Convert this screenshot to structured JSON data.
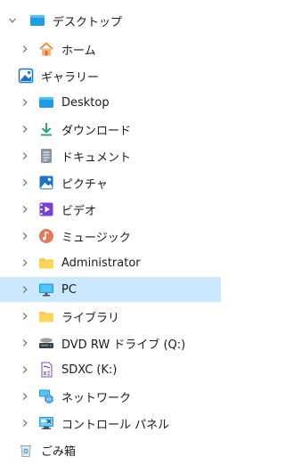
{
  "tree": {
    "root": {
      "label": "デスクトップ",
      "icon": "desktop-folder-icon",
      "expanded": true
    },
    "items": [
      {
        "label": "ホーム",
        "icon": "home-icon",
        "expandable": true
      },
      {
        "label": "ギャラリー",
        "icon": "gallery-icon",
        "expandable": false
      },
      {
        "label": "Desktop",
        "icon": "desktop-folder-icon",
        "expandable": true
      },
      {
        "label": "ダウンロード",
        "icon": "download-arrow-icon",
        "expandable": true
      },
      {
        "label": "ドキュメント",
        "icon": "document-icon",
        "expandable": true
      },
      {
        "label": "ピクチャ",
        "icon": "pictures-icon",
        "expandable": true
      },
      {
        "label": "ビデオ",
        "icon": "video-icon",
        "expandable": true
      },
      {
        "label": "ミュージック",
        "icon": "music-icon",
        "expandable": true
      },
      {
        "label": "Administrator",
        "icon": "user-folder-icon",
        "expandable": true
      },
      {
        "label": "PC",
        "icon": "pc-monitor-icon",
        "expandable": true,
        "selected": true
      },
      {
        "label": "ライブラリ",
        "icon": "library-folder-icon",
        "expandable": true
      },
      {
        "label": "DVD RW ドライブ (Q:)",
        "icon": "dvd-drive-icon",
        "expandable": true
      },
      {
        "label": "SDXC (K:)",
        "icon": "sd-card-icon",
        "expandable": true
      },
      {
        "label": "ネットワーク",
        "icon": "network-icon",
        "expandable": true
      },
      {
        "label": "コントロール パネル",
        "icon": "control-panel-icon",
        "expandable": true
      },
      {
        "label": "ごみ箱",
        "icon": "recycle-bin-icon",
        "expandable": false
      }
    ]
  },
  "colors": {
    "selection": "#cce8ff",
    "chevron": "#6b6b6b",
    "folder": "#f8c94a",
    "accent": "#0f8ad6"
  }
}
